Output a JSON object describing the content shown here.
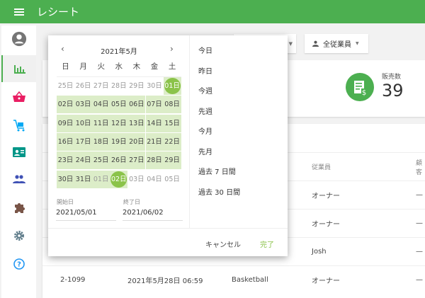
{
  "header": {
    "title": "レシート"
  },
  "sidebar": {
    "items": [
      {
        "name": "account",
        "icon": "account-circle-icon",
        "color": "#757575"
      },
      {
        "name": "reports",
        "icon": "bar-chart-icon",
        "color": "#4caf50",
        "active": true
      },
      {
        "name": "items",
        "icon": "basket-icon",
        "color": "#e91e63"
      },
      {
        "name": "inventory",
        "icon": "cart-icon",
        "color": "#03a9f4"
      },
      {
        "name": "employees",
        "icon": "id-card-icon",
        "color": "#009688"
      },
      {
        "name": "customers",
        "icon": "people-icon",
        "color": "#3f51b5"
      },
      {
        "name": "integrations",
        "icon": "puzzle-icon",
        "color": "#795548"
      },
      {
        "name": "settings",
        "icon": "gear-icon",
        "color": "#607d8b"
      },
      {
        "name": "help",
        "icon": "help-icon",
        "color": "#2196f3"
      }
    ]
  },
  "filters": {
    "employee": "全従業員"
  },
  "summary": {
    "label": "販売数",
    "value": "39",
    "icon_color": "#4caf50"
  },
  "table": {
    "columns": [
      "従業員",
      "顧客"
    ],
    "rows": [
      {
        "employee": "オーナー",
        "customer": "—"
      },
      {
        "employee": "オーナー",
        "customer": "—"
      },
      {
        "employee": "Josh",
        "customer": "—"
      },
      {
        "receipt": "2-1099",
        "date": "2021年5月28日 06:59",
        "store": "Basketball",
        "employee": "オーナー",
        "customer": "—"
      }
    ]
  },
  "datepicker": {
    "month_label": "2021年5月",
    "weekdays": [
      "日",
      "月",
      "火",
      "水",
      "木",
      "金",
      "土"
    ],
    "weeks": [
      [
        "25日",
        "26日",
        "27日",
        "28日",
        "29日",
        "30日",
        "01日"
      ],
      [
        "02日",
        "03日",
        "04日",
        "05日",
        "06日",
        "07日",
        "08日"
      ],
      [
        "09日",
        "10日",
        "11日",
        "12日",
        "13日",
        "14日",
        "15日"
      ],
      [
        "16日",
        "17日",
        "18日",
        "19日",
        "20日",
        "21日",
        "22日"
      ],
      [
        "23日",
        "24日",
        "25日",
        "26日",
        "27日",
        "28日",
        "29日"
      ],
      [
        "30日",
        "31日",
        "01日",
        "02日",
        "03日",
        "04日",
        "05日"
      ]
    ],
    "start_label": "開始日",
    "start_value": "2021/05/01",
    "end_label": "終了日",
    "end_value": "2021/06/02",
    "presets": [
      "今日",
      "昨日",
      "今週",
      "先週",
      "今月",
      "先月",
      "過去 7 日間",
      "過去 30 日間"
    ],
    "cancel": "キャンセル",
    "done": "完了",
    "accent": "#8bc34a",
    "range_color": "#dcedc8"
  }
}
